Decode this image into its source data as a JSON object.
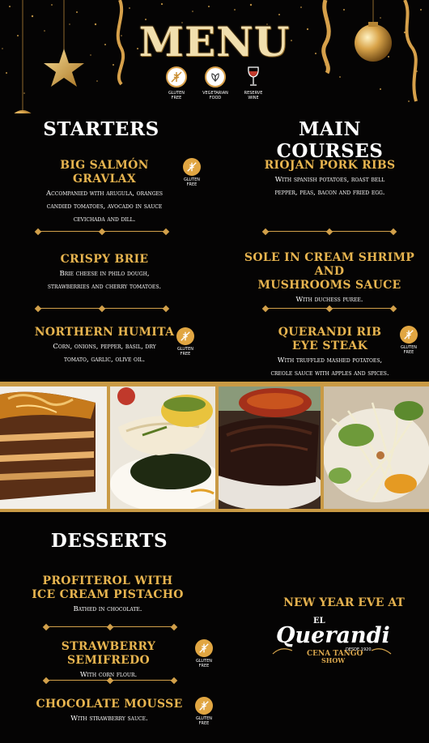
{
  "header": {
    "title": "MENU",
    "legend": [
      {
        "icon": "gluten-free-icon",
        "label_1": "GLUTEN",
        "label_2": "FREE"
      },
      {
        "icon": "vegetarian-leaf-icon",
        "label_1": "VEGETARIAN",
        "label_2": "FOOD"
      },
      {
        "icon": "wine-glass-icon",
        "label_1": "RESERVE",
        "label_2": "WINE"
      }
    ]
  },
  "starters": {
    "heading": "STARTERS",
    "items": [
      {
        "name": "BIG SALMÓN GRAVLAX",
        "desc_1": "Accompanied with arugula, oranges",
        "desc_2": "candied tomatoes, avocado in sauce",
        "desc_3": "cevichada and dill.",
        "badge": "gluten-free"
      },
      {
        "name": "CRISPY BRIE",
        "desc_1": "Brie cheese in philo  dough,",
        "desc_2": "strawberries and cherry tomatoes."
      },
      {
        "name": "NORTHERN HUMITA",
        "desc_1": "Corn, onions, pepper, basil, dry",
        "desc_2": "tomato, garlic, olive oil.",
        "badge": "gluten-free"
      }
    ]
  },
  "main_courses": {
    "heading": "MAIN COURSES",
    "items": [
      {
        "name": "RIOJAN PORK RIBS",
        "desc_1": "With spanish potatoes, roast bell",
        "desc_2": "pepper, peas, bacon and fried egg."
      },
      {
        "name_1": "SOLE IN CREAM SHRIMP AND",
        "name_2": "MUSHROOMS SAUCE",
        "desc_1": "With duchess puree."
      },
      {
        "name_1": "QUERANDI RIB",
        "name_2": "EYE STEAK",
        "desc_1": "With truffled mashed potatoes,",
        "desc_2": "creole sauce with apples and spices.",
        "badge": "gluten-free"
      }
    ]
  },
  "desserts": {
    "heading": "DESSERTS",
    "items": [
      {
        "name_1": "PROFITEROL WITH",
        "name_2": "ICE CREAM PISTACHO",
        "desc_1": "Bathed in chocolate."
      },
      {
        "name": "STRAWBERRY SEMIFREDO",
        "desc_1": "With corn flour.",
        "badge": "gluten-free"
      },
      {
        "name": "CHOCOLATE MOUSSE",
        "desc_1": "With strawberry sauce.",
        "badge": "gluten-free"
      }
    ]
  },
  "badge": {
    "line_1": "GLUTEN",
    "line_2": "FREE"
  },
  "event": {
    "title": "NEW YEAR EVE AT",
    "logo_el": "EL",
    "logo_name": "Querandi",
    "logo_since": "DESDE 1920",
    "logo_cena": "CENA TANGO",
    "logo_show": "SHOW"
  },
  "colors": {
    "gold": "#e3b04e",
    "background": "#050404",
    "frame": "#c99a45"
  }
}
